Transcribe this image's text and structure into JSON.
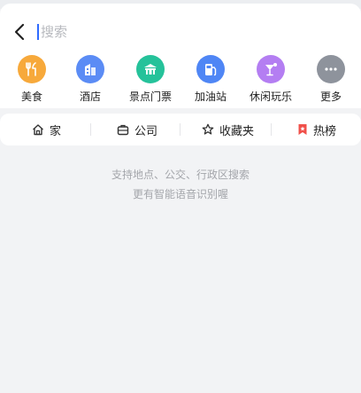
{
  "search": {
    "placeholder": "搜索"
  },
  "categories": [
    {
      "label": "美食",
      "icon": "food-icon",
      "color": "#f7a93b"
    },
    {
      "label": "酒店",
      "icon": "hotel-icon",
      "color": "#5b8cf5"
    },
    {
      "label": "景点门票",
      "icon": "scenic-icon",
      "color": "#25c29a"
    },
    {
      "label": "加油站",
      "icon": "fuel-icon",
      "color": "#4f86f5"
    },
    {
      "label": "休闲玩乐",
      "icon": "leisure-icon",
      "color": "#b47ef2"
    },
    {
      "label": "更多",
      "icon": "more-icon",
      "color": "#8e939c"
    }
  ],
  "quick_links": {
    "home": "家",
    "company": "公司",
    "favorites": "收藏夹",
    "hot_list": "热榜"
  },
  "hint": {
    "line1": "支持地点、公交、行政区搜索",
    "line2": "更有智能语音识别喔"
  },
  "colors": {
    "accent": "#2f6bff",
    "hot_list": "#f0504a"
  }
}
